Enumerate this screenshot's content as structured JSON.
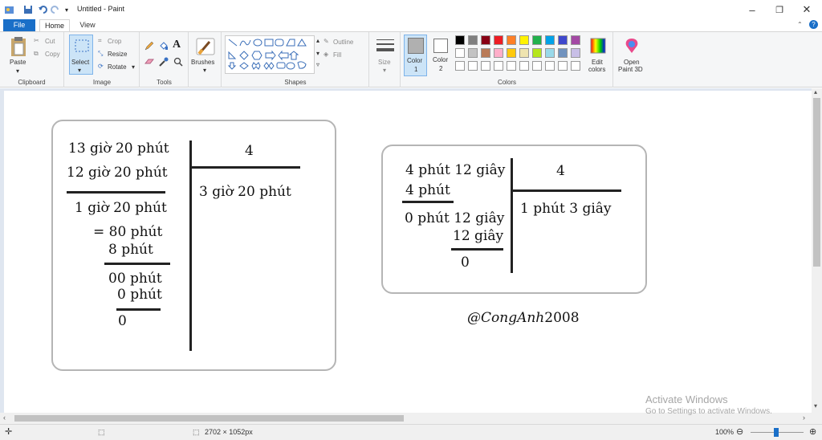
{
  "window": {
    "title": "Untitled - Paint",
    "minimize": "–",
    "maximize": "❐",
    "close": "✕"
  },
  "tabs": {
    "file": "File",
    "home": "Home",
    "view": "View"
  },
  "ribbon": {
    "clipboard": {
      "label": "Clipboard",
      "paste": "Paste",
      "cut": "Cut",
      "copy": "Copy"
    },
    "image": {
      "label": "Image",
      "select": "Select",
      "crop": "Crop",
      "resize": "Resize",
      "rotate": "Rotate"
    },
    "tools": {
      "label": "Tools",
      "text_glyph": "A"
    },
    "brushes": {
      "label": "Brushes"
    },
    "shapes": {
      "label": "Shapes",
      "outline": "Outline",
      "fill": "Fill"
    },
    "size": {
      "label": "Size"
    },
    "colors": {
      "label": "Colors",
      "color1": "Color",
      "color1_num": "1",
      "color2": "Color",
      "color2_num": "2",
      "edit": "Edit",
      "edit2": "colors",
      "palette_row1": [
        "#000000",
        "#7f7f7f",
        "#880015",
        "#ed1c24",
        "#ff7f27",
        "#fff200",
        "#22b14c",
        "#00a2e8",
        "#3f48cc",
        "#a349a4"
      ],
      "palette_row2": [
        "#ffffff",
        "#c3c3c3",
        "#b97a57",
        "#ffaec9",
        "#ffc90e",
        "#efe4b0",
        "#b5e61d",
        "#99d9ea",
        "#7092be",
        "#c8bfe7"
      ],
      "palette_row3": [
        "#ffffff",
        "#ffffff",
        "#ffffff",
        "#ffffff",
        "#ffffff",
        "#ffffff",
        "#ffffff",
        "#ffffff",
        "#ffffff",
        "#ffffff"
      ]
    },
    "paint3d": {
      "line1": "Open",
      "line2": "Paint 3D"
    }
  },
  "canvas": {
    "left_division": {
      "dividend": "13 giờ 20 phút",
      "sub1": "12 giờ 20 phút",
      "rem1": "1 giờ 20 phút",
      "conv": "= 80 phút",
      "sub2": "8   phút",
      "rem2": "00 phút",
      "sub3": "0 phút",
      "rem3": "0",
      "divisor": "4",
      "quotient": "3 giờ  20 phút"
    },
    "right_division": {
      "dividend": "4 phút 12 giây",
      "sub1": "4 phút",
      "rem1": "0 phút 12 giây",
      "sub2": "12 giây",
      "rem2": "0",
      "divisor": "4",
      "quotient": "1 phút 3 giây"
    },
    "signature_italic": "@CongAnh",
    "signature_year": "2008"
  },
  "status": {
    "dimensions": "2702 × 1052px",
    "zoom": "100%"
  },
  "watermark": {
    "line1": "Activate Windows",
    "line2": "Go to Settings to activate Windows."
  }
}
